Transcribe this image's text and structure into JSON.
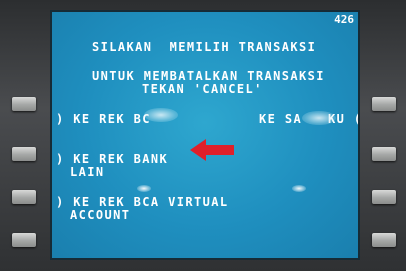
{
  "screen": {
    "code": "426",
    "title": "SILAKAN  MEMILIH TRANSAKSI",
    "cancel_line1": "UNTUK MEMBATALKAN TRANSAKSI",
    "cancel_line2": "TEKAN 'CANCEL'"
  },
  "options": {
    "left1": ") KE REK BC",
    "right1": "KE SA   KU (",
    "left2_line1": ") KE REK BANK",
    "left2_line2": "LAIN",
    "left3_line1": ") KE REK BCA VIRTUAL",
    "left3_line2": "ACCOUNT"
  },
  "colors": {
    "screen": "#1f8fbf",
    "text": "#ffffff",
    "arrow": "#e0202a"
  }
}
